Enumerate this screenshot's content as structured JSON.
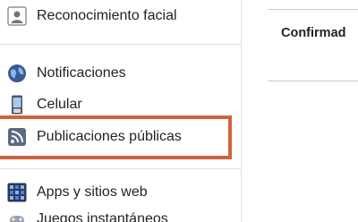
{
  "sidebar": {
    "items": [
      {
        "label": "Reconocimiento facial",
        "icon": "face-recognition-icon"
      },
      {
        "label": "Notificaciones",
        "icon": "globe-notifications-icon"
      },
      {
        "label": "Celular",
        "icon": "mobile-phone-icon"
      },
      {
        "label": "Publicaciones públicas",
        "icon": "rss-feed-icon"
      },
      {
        "label": "Apps y sitios web",
        "icon": "apps-grid-icon"
      },
      {
        "label": "Juegos instantáneos",
        "icon": "game-controller-icon"
      }
    ],
    "highlight_color": "#d0633e"
  },
  "content": {
    "heading": "Confirmad"
  }
}
